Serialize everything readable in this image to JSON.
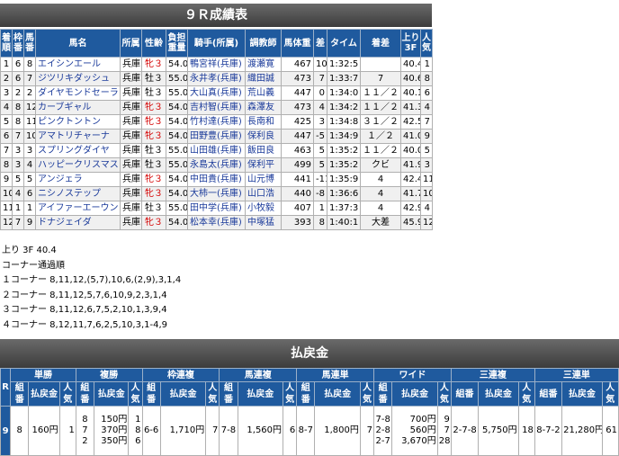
{
  "title": "９Ｒ成績表",
  "headers": [
    "着順",
    "枠番",
    "馬番",
    "馬名",
    "所属",
    "性齢",
    "負担重量",
    "騎手(所属)",
    "調教師",
    "馬体重",
    "差",
    "タイム",
    "着差",
    "上り3F",
    "人気"
  ],
  "rows": [
    [
      "1",
      "6",
      "8",
      "エイシンエール",
      "兵庫",
      "牝３",
      "54.0",
      "鴨宮祥(兵庫)",
      "渡瀬寛",
      "467",
      "10",
      "1:32:5",
      "",
      "40.4",
      "1"
    ],
    [
      "2",
      "6",
      "7",
      "ジツリキダッシュ",
      "兵庫",
      "牡３",
      "55.0",
      "永井孝(兵庫)",
      "織田誠",
      "473",
      "7",
      "1:33:7",
      "7",
      "40.6",
      "8"
    ],
    [
      "3",
      "2",
      "2",
      "ダイヤモンドセーラ",
      "兵庫",
      "牡３",
      "55.0",
      "大山真(兵庫)",
      "荒山義",
      "447",
      "0",
      "1:34:0",
      "１１／２",
      "40.1",
      "6"
    ],
    [
      "4",
      "8",
      "12",
      "カーブギャル",
      "兵庫",
      "牝３",
      "54.0",
      "吉村智(兵庫)",
      "森澤友",
      "473",
      "4",
      "1:34:2",
      "１１／２",
      "41.3",
      "4"
    ],
    [
      "5",
      "8",
      "11",
      "ピンクトントン",
      "兵庫",
      "牝３",
      "54.0",
      "竹村達(兵庫)",
      "長南和",
      "425",
      "3",
      "1:34:8",
      "３１／２",
      "42.5",
      "7"
    ],
    [
      "6",
      "7",
      "10",
      "アマトリチャーナ",
      "兵庫",
      "牝３",
      "54.0",
      "田野豊(兵庫)",
      "保利良",
      "447",
      "-5",
      "1:34:9",
      "１／２",
      "41.0",
      "9"
    ],
    [
      "7",
      "3",
      "3",
      "スプリングダイヤ",
      "兵庫",
      "牡３",
      "55.0",
      "山田雄(兵庫)",
      "飯田良",
      "463",
      "5",
      "1:35:2",
      "１１／２",
      "40.0",
      "5"
    ],
    [
      "8",
      "3",
      "4",
      "ハッピークリスマス",
      "兵庫",
      "牡３",
      "55.0",
      "永島太(兵庫)",
      "保利平",
      "499",
      "5",
      "1:35:2",
      "クビ",
      "41.9",
      "3"
    ],
    [
      "9",
      "5",
      "5",
      "アンジェラ",
      "兵庫",
      "牝３",
      "54.0",
      "中田貴(兵庫)",
      "山元博",
      "441",
      "-11",
      "1:35:9",
      "4",
      "42.4",
      "11"
    ],
    [
      "10",
      "4",
      "6",
      "ニシノステップ",
      "兵庫",
      "牝３",
      "54.0",
      "大柿一(兵庫)",
      "山口浩",
      "440",
      "-8",
      "1:36:6",
      "4",
      "41.7",
      "10"
    ],
    [
      "11",
      "1",
      "1",
      "アイファーエーウン",
      "兵庫",
      "牡３",
      "55.0",
      "田中学(兵庫)",
      "小牧毅",
      "407",
      "1",
      "1:37:3",
      "4",
      "42.9",
      "4"
    ],
    [
      "12",
      "7",
      "9",
      "ドナジェイダ",
      "兵庫",
      "牝３",
      "54.0",
      "松本幸(兵庫)",
      "中塚猛",
      "393",
      "8",
      "1:40:1",
      "大差",
      "45.9",
      "12"
    ]
  ],
  "notes": [
    "上り 3F 40.4",
    "コーナー通過順",
    "１コーナー 8,11,12,(5,7),10,6,(2,9),3,1,4",
    "２コーナー 8,11,12,5,7,6,10,9,2,3,1,4",
    "３コーナー 8,11,12,6,7,5,2,10,1,3,9,4",
    "４コーナー 8,12,11,7,6,2,5,10,3,1-4,9"
  ],
  "payout_title": "払戻金",
  "payout_groups": [
    "単勝",
    "複勝",
    "枠連複",
    "馬連複",
    "馬連単",
    "ワイド",
    "三連複",
    "三連単"
  ],
  "payout_sub": [
    "組番",
    "払戻金",
    "人気"
  ],
  "race_label": "R",
  "race_no": "9",
  "payout": {
    "tansho": {
      "combo": [
        "8"
      ],
      "pay": [
        "160円"
      ],
      "pop": [
        "1"
      ]
    },
    "fukusho": {
      "combo": [
        "8",
        "7",
        "2"
      ],
      "pay": [
        "150円",
        "370円",
        "350円"
      ],
      "pop": [
        "1",
        "8",
        "6"
      ]
    },
    "wakuren": {
      "combo": [
        "6-6"
      ],
      "pay": [
        "1,710円"
      ],
      "pop": [
        "7"
      ]
    },
    "umaren_fuku": {
      "combo": [
        "7-8"
      ],
      "pay": [
        "1,560円"
      ],
      "pop": [
        "6"
      ]
    },
    "umaren_tan": {
      "combo": [
        "8-7"
      ],
      "pay": [
        "1,800円"
      ],
      "pop": [
        "7"
      ]
    },
    "wide": {
      "combo": [
        "7-8",
        "2-8",
        "2-7"
      ],
      "pay": [
        "700円",
        "560円",
        "3,670円"
      ],
      "pop": [
        "9",
        "7",
        "28"
      ]
    },
    "sanrenpuku": {
      "combo": [
        "2-7-8"
      ],
      "pay": [
        "5,750円"
      ],
      "pop": [
        "18"
      ]
    },
    "sanrentan": {
      "combo": [
        "8-7-2"
      ],
      "pay": [
        "21,280円"
      ],
      "pop": [
        "61"
      ]
    }
  },
  "colors": {
    "header_blue": "#1f5a9e",
    "title_gray": "#4a4a4a",
    "link_blue": "#1a3a9a",
    "female_red": "#d40000"
  }
}
